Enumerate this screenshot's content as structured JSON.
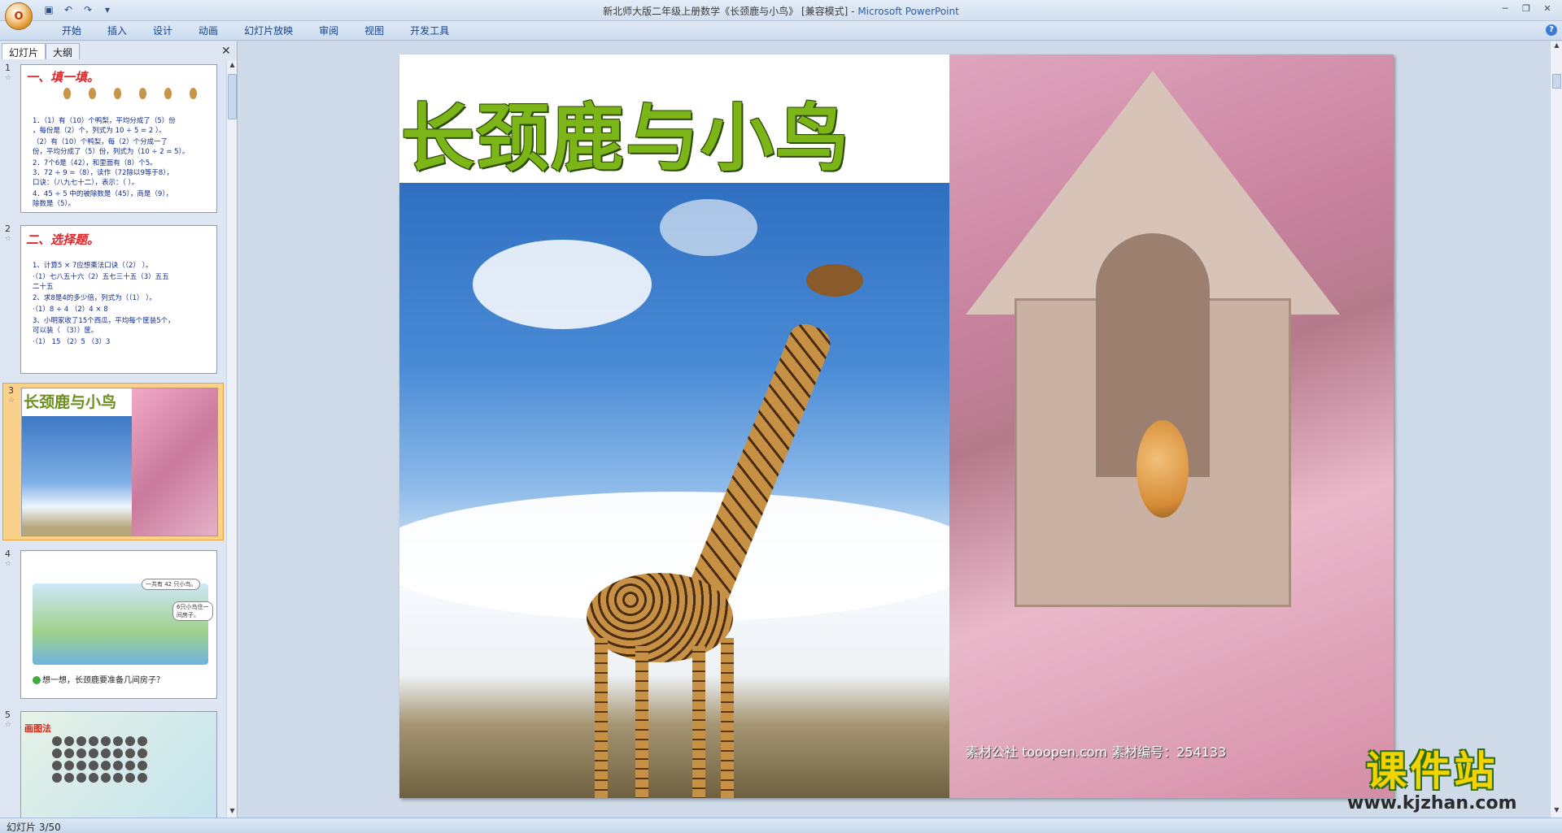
{
  "titlebar": {
    "document_title": "新北师大版二年级上册数学《长颈鹿与小鸟》 [兼容模式] - ",
    "app_name": "Microsoft PowerPoint",
    "office_button": "O"
  },
  "ribbon": {
    "tabs": [
      "开始",
      "插入",
      "设计",
      "动画",
      "幻灯片放映",
      "审阅",
      "视图",
      "开发工具"
    ]
  },
  "left_pane": {
    "tabs": [
      "幻灯片",
      "大纲"
    ],
    "slides": [
      {
        "number": "1",
        "heading": "一、填一填。",
        "lines": [
          "1．（1）有（10）个鸭梨，平均分成了（5）份",
          "，每份是（2）个，列式为 10 ÷ 5 = 2 ）。",
          "（2）有（10）个鸭梨，每（2）个分成一了",
          "份，平均分成了（5）份，列式为（10 ÷ 2 = 5）。",
          "2．7个6是（42），和里面有（8）个5。",
          "3．72 ÷ 9 =（8），读作（72除以9等于8），",
          "口诀：（八九七十二），表示：（    ）。",
          "4．45 ÷ 5 中的被除数是（45），商是（9），",
          "除数是（5）。"
        ]
      },
      {
        "number": "2",
        "heading": "二、选择题。",
        "lines": [
          "1、计算5 × 7应想乘法口诀（（2）  ）。",
          "·（1）七八五十六（2）五七三十五（3）五五",
          "二十五",
          "2、求8是4的多少倍，列式为（（1）  ）。",
          "·（1）8 ÷ 4   （2）4 × 8",
          "3、小明家收了15个西瓜，平均每个筐装5个，",
          "可以装（    （3））筐。",
          "·（1） 15    （2）5     （3）3"
        ]
      },
      {
        "number": "3",
        "title": "长颈鹿与小鸟"
      },
      {
        "number": "4",
        "bubble1": "一共有 42 只小鸟。",
        "bubble2": "6只小鸟住一间房子。",
        "question": "想一想，长颈鹿要准备几间房子？"
      },
      {
        "number": "5",
        "title": "画图法"
      }
    ]
  },
  "slide": {
    "title": "长颈鹿与小鸟",
    "photo_watermark": "素材公社 tooopen.com 素材编号：254133"
  },
  "logo": {
    "name": "课件站",
    "url": "www.kjzhan.com"
  },
  "statusbar": {
    "slide_position": "幻灯片 3/50"
  },
  "colors": {
    "title_green": "#7cb518",
    "selected_thumb": "#f9d18a",
    "ribbon_text": "#15428b"
  }
}
